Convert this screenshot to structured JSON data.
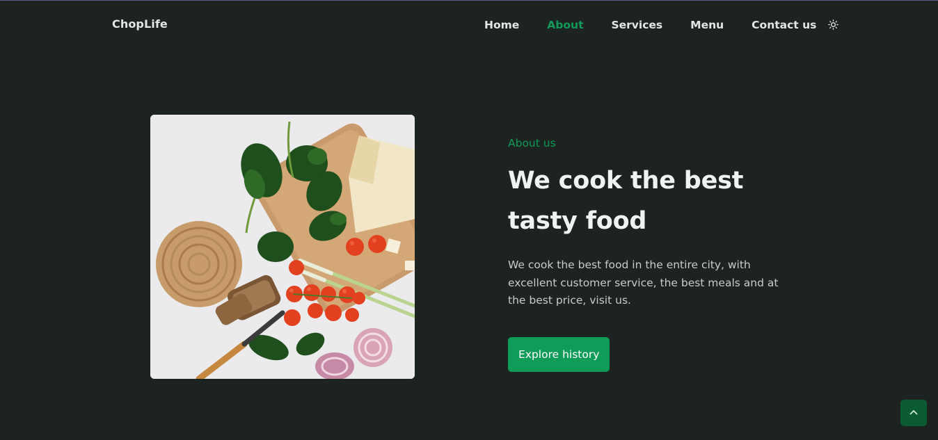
{
  "header": {
    "logo": "ChopLife",
    "nav": [
      {
        "label": "Home",
        "active": false
      },
      {
        "label": "About",
        "active": true
      },
      {
        "label": "Services",
        "active": false
      },
      {
        "label": "Menu",
        "active": false
      },
      {
        "label": "Contact us",
        "active": false
      }
    ],
    "theme_icon": "sun-icon"
  },
  "about": {
    "image_alt": "food ingredients",
    "subtitle": "About us",
    "title": "We cook the best tasty food",
    "description": "We cook the best food in the entire city, with excellent customer service, the best meals and at the best price, visit us.",
    "button_label": "Explore history"
  },
  "scroll_up": {
    "icon": "chevron-up-icon"
  },
  "colors": {
    "background": "#1d2320",
    "accent": "#0f9b58",
    "text": "#e3e6e4",
    "scroll_button": "#0c5c33"
  }
}
